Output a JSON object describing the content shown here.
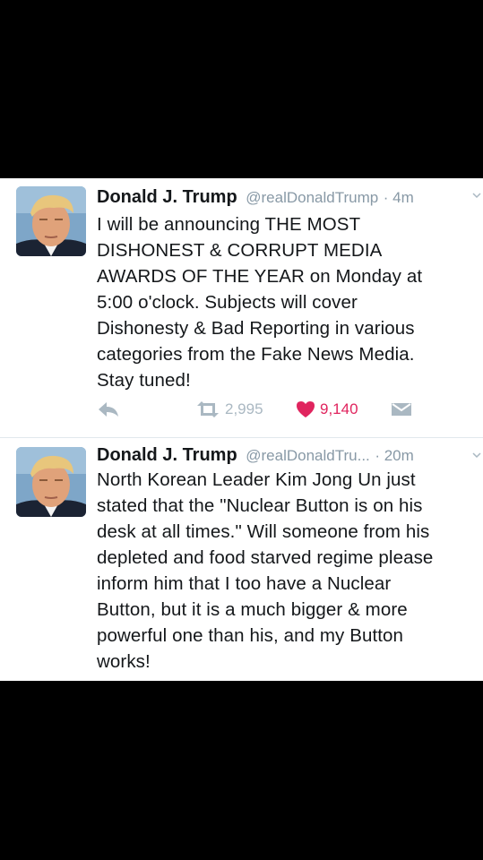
{
  "tweets": [
    {
      "name": "Donald J. Trump",
      "handle": "@realDonaldTrump",
      "time": "· 4m",
      "text": "I will be announcing THE MOST\nDISHONEST & CORRUPT MEDIA\nAWARDS OF THE YEAR on Monday at\n5:00 o'clock. Subjects will cover\nDishonesty & Bad Reporting in various\ncategories from the Fake News Media.\nStay tuned!",
      "retweets": "2,995",
      "likes": "9,140"
    },
    {
      "name": "Donald J. Trump",
      "handle": "@realDonaldTru...",
      "time": "· 20m",
      "text": "North Korean Leader Kim Jong Un just\nstated that the \"Nuclear Button is on his\ndesk at all times.\" Will someone from his\ndepleted and food starved regime please\ninform him that I too have a Nuclear\nButton, but it is a much bigger & more\npowerful one than his, and my Button\nworks!"
    }
  ],
  "colors": {
    "retweet": "#aab8c2",
    "like": "#e0245e",
    "muted": "#8899a6"
  },
  "icons": [
    "reply-icon",
    "retweet-icon",
    "heart-icon",
    "direct-message-icon",
    "caret-down-icon"
  ]
}
